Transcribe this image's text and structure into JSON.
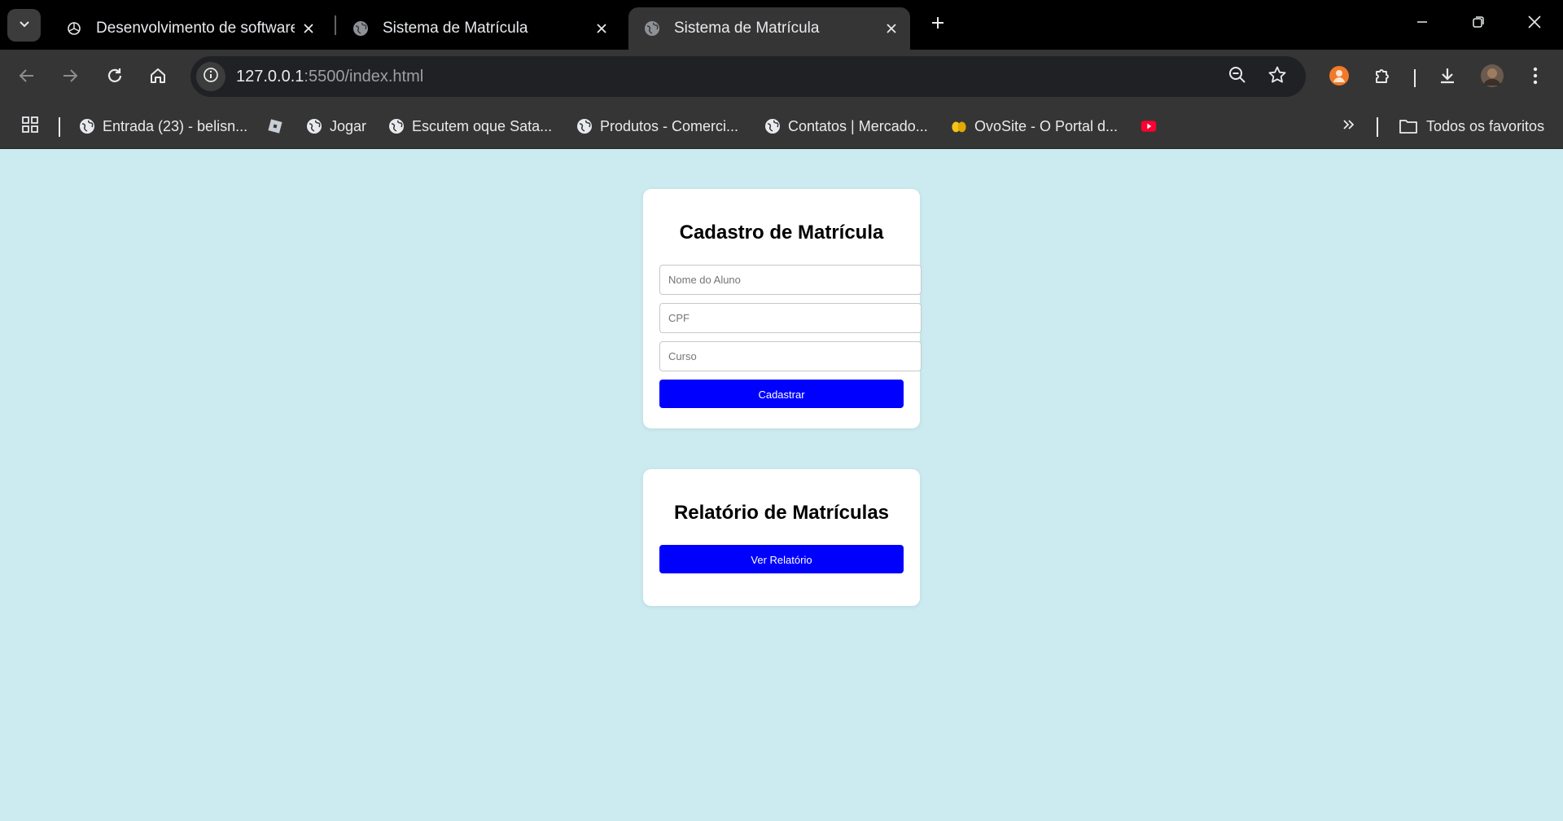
{
  "browser": {
    "tabs": [
      {
        "title": "Desenvolvimento de software w",
        "icon": "openai-icon",
        "active": false
      },
      {
        "title": "Sistema de Matrícula",
        "icon": "globe-icon",
        "active": false
      },
      {
        "title": "Sistema de Matrícula",
        "icon": "globe-icon",
        "active": true
      }
    ],
    "url_host": "127.0.0.1",
    "url_rest": ":5500/index.html",
    "bookmarks": [
      {
        "label": "Entrada (23) - belisn...",
        "icon": "globe-icon"
      },
      {
        "label": "",
        "icon": "roblox-icon"
      },
      {
        "label": "Jogar",
        "icon": "globe-icon"
      },
      {
        "label": "Escutem oque Sata...",
        "icon": "globe-icon"
      },
      {
        "label": "Produtos - Comerci...",
        "icon": "globe-icon"
      },
      {
        "label": "Contatos | Mercado...",
        "icon": "globe-icon"
      },
      {
        "label": "OvoSite - O Portal d...",
        "icon": "eggs-icon"
      },
      {
        "label": "",
        "icon": "youtube-icon"
      }
    ],
    "all_bookmarks_label": "Todos os favoritos",
    "colors": {
      "chrome_dark": "#000000",
      "toolbar": "#353535",
      "omnibox": "#202124"
    }
  },
  "page": {
    "background": "#cbebf0",
    "cadastro": {
      "title": "Cadastro de Matrícula",
      "nome_placeholder": "Nome do Aluno",
      "cpf_placeholder": "CPF",
      "curso_placeholder": "Curso",
      "submit_label": "Cadastrar"
    },
    "relatorio": {
      "title": "Relatório de Matrículas",
      "button_label": "Ver Relatório"
    },
    "accent": "#0000ff"
  }
}
